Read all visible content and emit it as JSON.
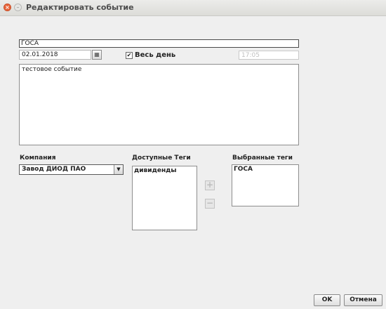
{
  "window": {
    "title": "Редактировать событие",
    "close_glyph": "×",
    "minimize_glyph": "–"
  },
  "form": {
    "name": "ГОСА",
    "date": "02.01.2018",
    "calendar_glyph": "▦",
    "all_day_label": "Весь день",
    "all_day_checked": true,
    "all_day_glyph": "✔",
    "time": "17:05",
    "description": "тестовое событие"
  },
  "company": {
    "label": "Компания",
    "selected": "Завод ДИОД ПАО",
    "arrow_glyph": "▼"
  },
  "available_tags": {
    "label": "Доступные Теги",
    "items": [
      "дивиденды"
    ]
  },
  "selected_tags": {
    "label": "Выбранные теги",
    "items": [
      "ГОСА"
    ]
  },
  "movers": {
    "add_glyph": "+",
    "remove_glyph": "−"
  },
  "buttons": {
    "ok": "OK",
    "cancel": "Отмена"
  },
  "colors": {
    "background": "#efefef",
    "close_button": "#e8643a",
    "disabled_text": "#c0c0c0"
  }
}
